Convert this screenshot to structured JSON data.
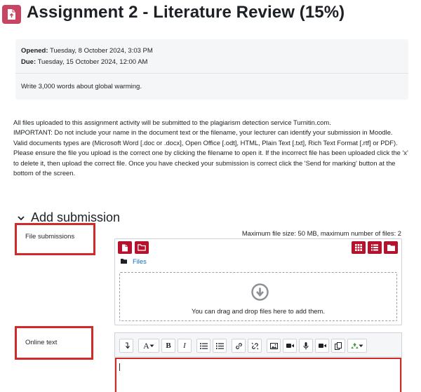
{
  "header": {
    "title": "Assignment 2 - Literature Review (15%)",
    "icon": "assignment-upload-icon",
    "accent": "#c64563"
  },
  "dates": {
    "opened_label": "Opened:",
    "opened_value": "Tuesday, 8 October 2024, 3:03 PM",
    "due_label": "Due:",
    "due_value": "Tuesday, 15 October 2024, 12:00 AM",
    "description": "Write 3,000 words about global warming."
  },
  "instructions": [
    "All files uploaded to this assignment activity will be submitted to the plagiarism detection service Turnitin.com.",
    "IMPORTANT: Do not include your name in the document text or the filename, your lecturer can identify your submission in Moodle.",
    "Valid documents types are (Microsoft Word [.doc or .docx], Open Office [.odt], HTML, Plain Text [.txt], Rich Text Format [.rtf] or PDF).",
    "Please ensure the file you upload is the correct one by clicking the filename to open it. If the incorrect file has been uploaded click the 'x' to delete it, then upload the correct file. Once you have checked your submission is correct click the 'Send for marking' button at the bottom of the screen."
  ],
  "section": {
    "title": "Add submission"
  },
  "file_submissions": {
    "label": "File submissions",
    "max_info": "Maximum file size: 50 MB, maximum number of files: 2",
    "files_link": "Files",
    "drop_text": "You can drag and drop files here to add them.",
    "button_color": "#b5122e"
  },
  "online_text": {
    "label": "Online text",
    "toolbar_icons": [
      "collapse-icon",
      "font-color-icon",
      "bold-icon",
      "italic-icon",
      "unordered-list-icon",
      "ordered-list-icon",
      "link-icon",
      "unlink-icon",
      "image-icon",
      "video-icon",
      "record-audio-icon",
      "record-video-icon",
      "manage-files-icon",
      "accessibility-checker-icon"
    ]
  },
  "highlight_color": "#d22a2a"
}
